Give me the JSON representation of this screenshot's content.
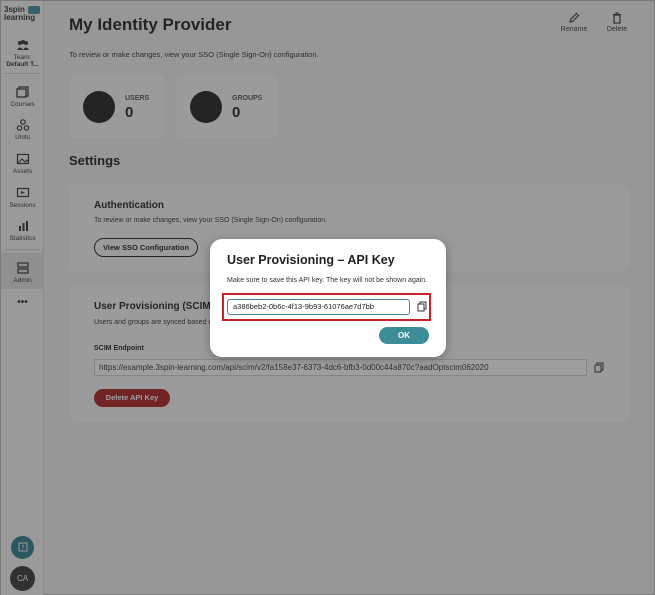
{
  "sidebar": {
    "logo_line1": "3spin",
    "logo_line2": "learning",
    "team_label": "Team:",
    "team_name": "Default T...",
    "items": [
      {
        "label": "Courses",
        "icon": "courses-icon"
      },
      {
        "label": "Units",
        "icon": "units-icon"
      },
      {
        "label": "Assets",
        "icon": "assets-icon"
      },
      {
        "label": "Sessions",
        "icon": "sessions-icon"
      },
      {
        "label": "Statistics",
        "icon": "statistics-icon"
      },
      {
        "label": "Admin",
        "icon": "admin-icon"
      }
    ],
    "more": "•••",
    "help_icon": "help-icon",
    "avatar_initials": "CA"
  },
  "header": {
    "title": "My Identity Provider",
    "subtitle": "To review or make changes, view your SSO (Single Sign-On) configuration.",
    "rename_label": "Rename",
    "delete_label": "Delete"
  },
  "stats": [
    {
      "label": "USERS",
      "value": "0"
    },
    {
      "label": "GROUPS",
      "value": "0"
    }
  ],
  "settings": {
    "title": "Settings",
    "auth": {
      "title": "Authentication",
      "text": "To review or make changes, view your SSO (Single Sign-On) configuration.",
      "button": "View SSO Configuration"
    },
    "scim": {
      "title": "User Provisioning (SCIM)",
      "text": "Users and groups are synced based on y",
      "endpoint_label": "SCIM Endpoint",
      "endpoint_value": "https://example.3spin-learning.com/api/scim/v2/fa158e37-6373-4dc6-bfb3-0d00c44a870c?aadOptscim062020",
      "delete_button": "Delete API Key"
    }
  },
  "modal": {
    "title": "User Provisioning – API Key",
    "subtitle": "Make sure to save this API key. The key will not be shown again.",
    "api_key": "a386beb2-0b6c-4f13-9b93-61076ae7d7bb",
    "ok_label": "OK"
  },
  "colors": {
    "accent": "#3d8d99",
    "danger": "#b02224",
    "highlight": "#cc1f2d"
  }
}
